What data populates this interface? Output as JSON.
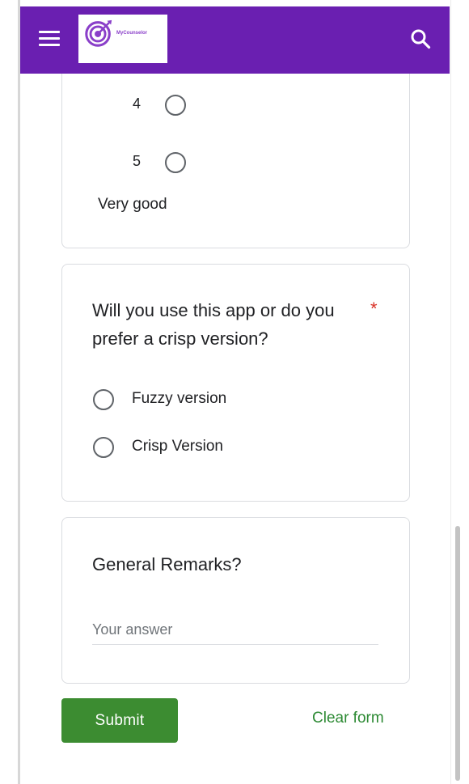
{
  "app": {
    "brand_name": "MyCounselor",
    "colors": {
      "header": "#6a1fb1",
      "submit": "#3c8c31",
      "link": "#2d8a34",
      "required": "#d93025"
    }
  },
  "rating_question": {
    "options": [
      {
        "value": "4",
        "selected": false
      },
      {
        "value": "5",
        "selected": false
      }
    ],
    "high_label": "Very good"
  },
  "version_question": {
    "title": "Will you use this app or do you prefer a crisp version?",
    "required_mark": "*",
    "options": [
      {
        "label": "Fuzzy version",
        "selected": false
      },
      {
        "label": "Crisp Version",
        "selected": false
      }
    ]
  },
  "remarks_question": {
    "title": "General Remarks?",
    "placeholder": "Your answer",
    "value": ""
  },
  "actions": {
    "submit_label": "Submit",
    "clear_label": "Clear form"
  },
  "icons": [
    "menu-icon",
    "logo-icon",
    "search-icon"
  ]
}
